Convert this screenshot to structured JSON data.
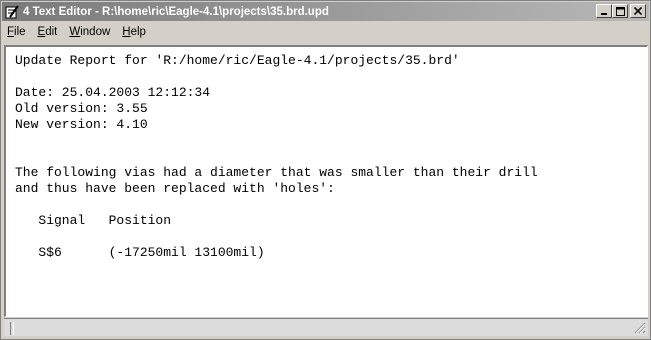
{
  "window": {
    "title": "4 Text Editor - R:\\home\\ric\\Eagle-4.1\\projects\\35.brd.upd",
    "buttons": {
      "minimize": "_",
      "maximize": "□",
      "close": "×"
    }
  },
  "menu": {
    "file": {
      "mnemonic": "F",
      "rest": "ile"
    },
    "edit": {
      "mnemonic": "E",
      "rest": "dit"
    },
    "window": {
      "mnemonic": "W",
      "rest": "indow"
    },
    "help": {
      "mnemonic": "H",
      "rest": "elp"
    }
  },
  "editor": {
    "lines": [
      "Update Report for 'R:/home/ric/Eagle-4.1/projects/35.brd'",
      "",
      "Date: 25.04.2003 12:12:34",
      "Old version: 3.55",
      "New version: 4.10",
      "",
      "",
      "The following vias had a diameter that was smaller than their drill",
      "and thus have been replaced with 'holes':",
      "",
      "   Signal   Position",
      "",
      "   S$6      (-17250mil 13100mil)"
    ]
  },
  "colors": {
    "titlebar": "#7a7a7a",
    "chrome": "#d4d0c8",
    "editor_bg": "#ffffff"
  }
}
